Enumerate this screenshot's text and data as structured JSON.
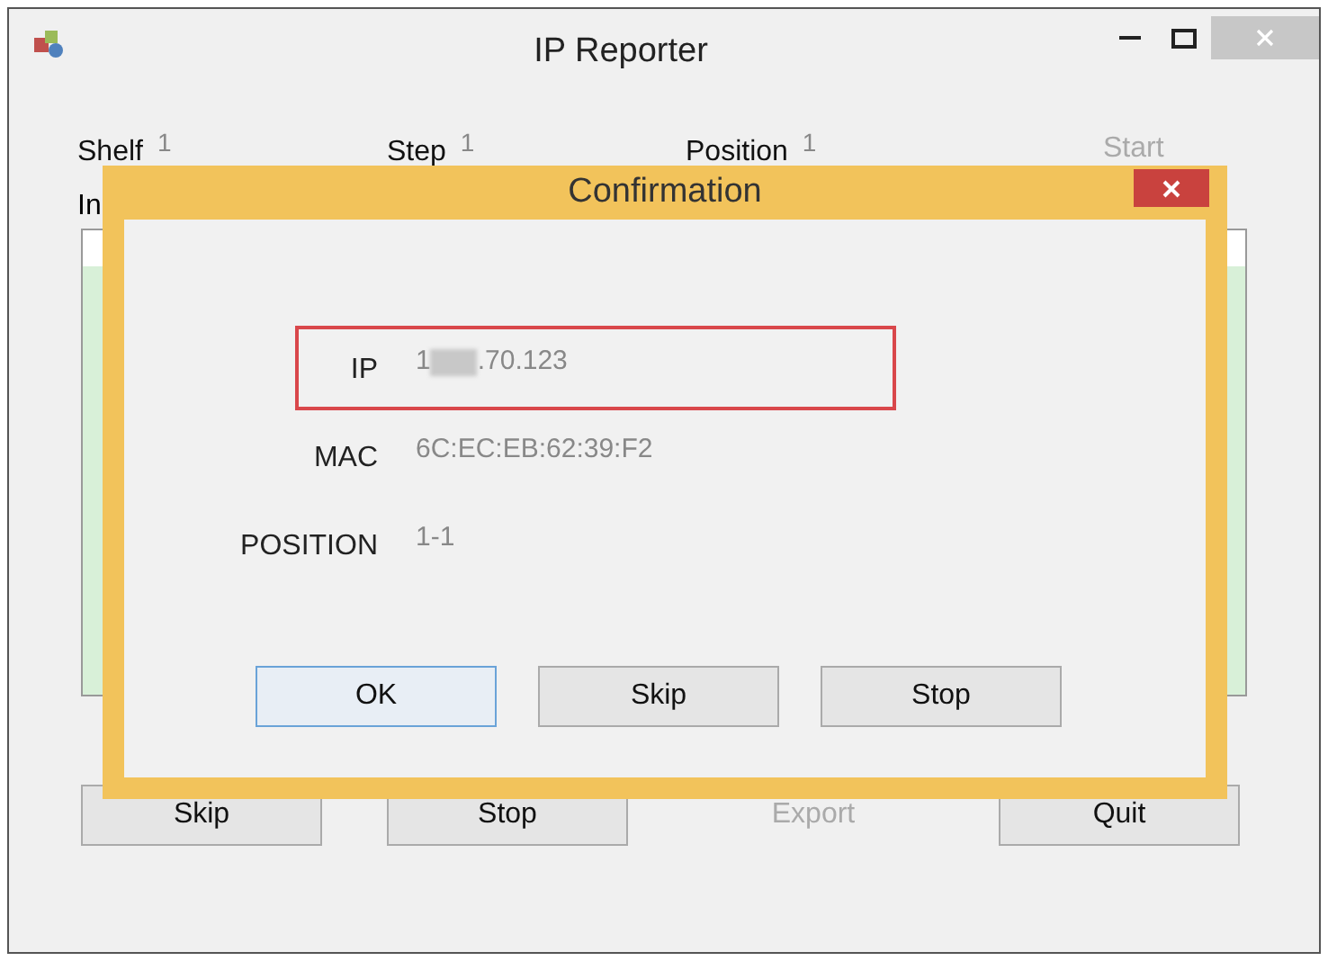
{
  "window": {
    "title": "IP Reporter"
  },
  "fields": [
    {
      "label": "Shelf",
      "value": "1"
    },
    {
      "label": "Step",
      "value": "1"
    },
    {
      "label": "Position",
      "value": "1"
    }
  ],
  "start_button": {
    "label": "Start",
    "disabled": true
  },
  "list_label": "In",
  "buttons": [
    {
      "label": "Skip",
      "disabled": false
    },
    {
      "label": "Stop",
      "disabled": false
    },
    {
      "label": "Export",
      "disabled": true
    },
    {
      "label": "Quit",
      "disabled": false
    }
  ],
  "dialog": {
    "title": "Confirmation",
    "rows": [
      {
        "label": "IP",
        "value_start": "1",
        "value_end": ".70.123",
        "highlighted": true
      },
      {
        "label": "MAC",
        "value_start": "6C:EC:EB:62:39:F2",
        "highlighted": false
      },
      {
        "label": "POSITION",
        "value_start": "1-1",
        "highlighted": false
      }
    ],
    "buttons": [
      {
        "label": "OK",
        "selected": true
      },
      {
        "label": "Skip",
        "selected": false
      },
      {
        "label": "Stop",
        "selected": false
      }
    ]
  }
}
